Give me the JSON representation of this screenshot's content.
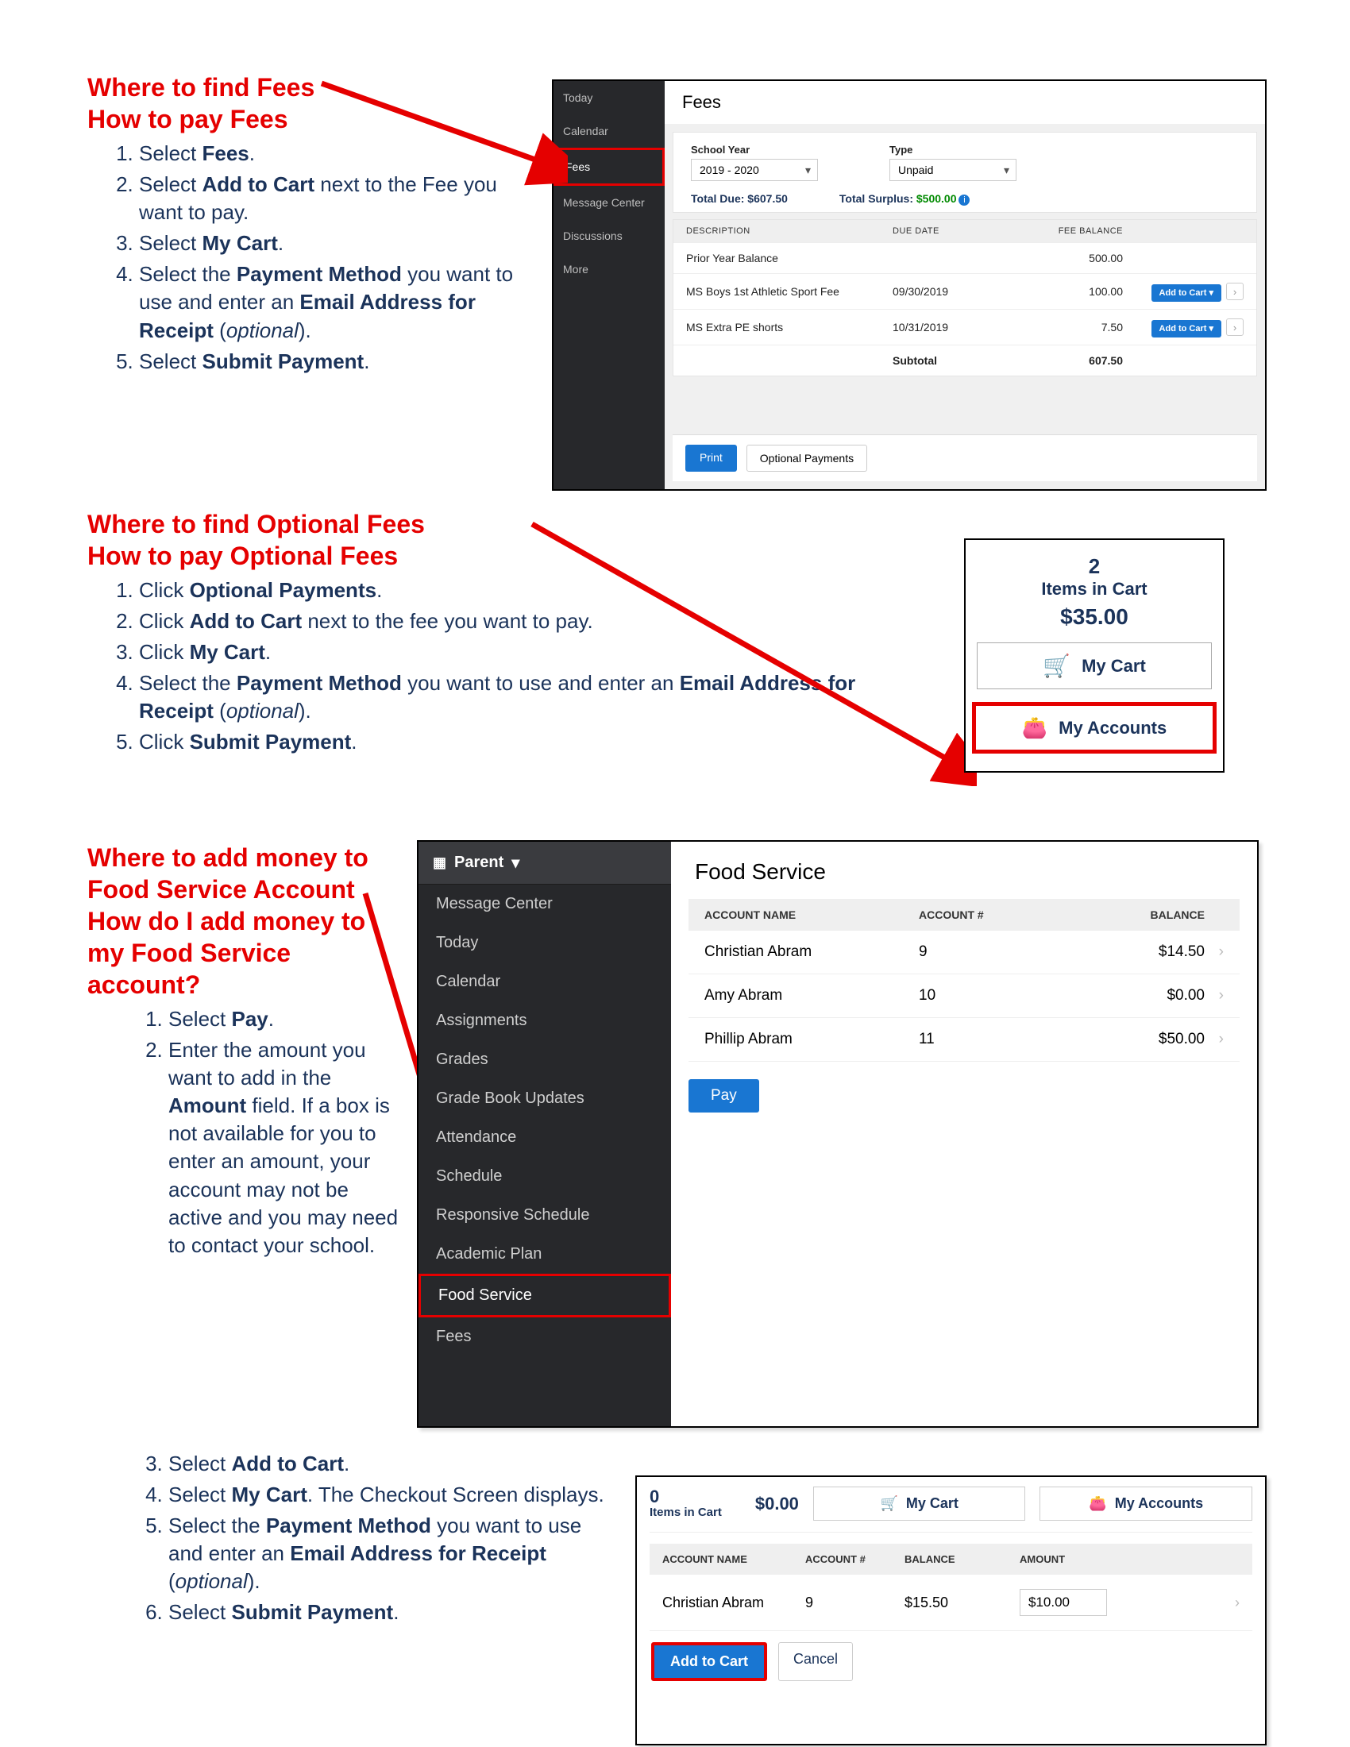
{
  "section1": {
    "h1a": "Where to find Fees",
    "h1b": "How to pay Fees",
    "steps": {
      "s1a": "Select ",
      "s1b": "Fees",
      "s1c": ".",
      "s2a": "Select ",
      "s2b": "Add to Cart",
      "s2c": " next to the Fee you want to pay.",
      "s3a": "Select ",
      "s3b": "My Cart",
      "s3c": ".",
      "s4a": "Select the ",
      "s4b": "Payment Method",
      "s4c": " you want to use and enter an ",
      "s4d": "Email Address for Receipt",
      "s4e": " (",
      "s4f": "optional",
      "s4g": ").",
      "s5a": "Select ",
      "s5b": "Submit Payment",
      "s5c": "."
    }
  },
  "fees_shot": {
    "nav": {
      "today": "Today",
      "calendar": "Calendar",
      "fees": "Fees",
      "messageCenter": "Message Center",
      "discussions": "Discussions",
      "more": "More"
    },
    "title": "Fees",
    "schoolYearLabel": "School Year",
    "schoolYearValue": "2019 - 2020",
    "typeLabel": "Type",
    "typeValue": "Unpaid",
    "totalDueLabel": "Total Due: ",
    "totalDueValue": "$607.50",
    "totalSurplusLabel": "Total Surplus: ",
    "totalSurplusValue": "$500.00",
    "thDescription": "DESCRIPTION",
    "thDueDate": "DUE DATE",
    "thFeeBalance": "FEE BALANCE",
    "rows": [
      {
        "desc": "Prior Year Balance",
        "due": "",
        "bal": "500.00",
        "btn": ""
      },
      {
        "desc": "MS Boys 1st Athletic Sport Fee",
        "due": "09/30/2019",
        "bal": "100.00",
        "btn": "Add to Cart ▾"
      },
      {
        "desc": "MS Extra PE shorts",
        "due": "10/31/2019",
        "bal": "7.50",
        "btn": "Add to Cart ▾"
      }
    ],
    "subtotalLabel": "Subtotal",
    "subtotalValue": "607.50",
    "printLabel": "Print",
    "optionalLabel": "Optional Payments"
  },
  "section2": {
    "h1a": "Where to find Optional Fees",
    "h1b": "How to pay Optional Fees",
    "steps": {
      "s1a": "Click ",
      "s1b": "Optional Payments",
      "s1c": ".",
      "s2a": "Click ",
      "s2b": "Add to Cart",
      "s2c": " next to the fee you want to pay.",
      "s3a": "Click ",
      "s3b": "My Cart",
      "s3c": ".",
      "s4a": "Select the ",
      "s4b": "Payment Method",
      "s4c": " you want to use and enter an ",
      "s4d": "Email Address for Receipt",
      "s4e": " (",
      "s4f": "optional",
      "s4g": ").",
      "s5a": "Click ",
      "s5b": "Submit Payment",
      "s5c": "."
    }
  },
  "cart_panel": {
    "count": "2",
    "countLabel": "Items in Cart",
    "total": "$35.00",
    "myCart": "My Cart",
    "myAccounts": "My Accounts"
  },
  "section3": {
    "h1a": "Where to add money to Food Service Account",
    "h1b": "How do I add money to my Food Service account?",
    "steps_a": {
      "s1a": "Select ",
      "s1b": "Pay",
      "s1c": ".",
      "s2a": "Enter the amount you want to add in the ",
      "s2b": "Amount",
      "s2c": " field. If a box is not available for you to enter an amount, your account may not be active and you may need to contact your school."
    },
    "steps_b": {
      "s3a": "Select ",
      "s3b": "Add to Cart",
      "s3c": ".",
      "s4a": "Select ",
      "s4b": "My Cart",
      "s4c": ". The Checkout Screen displays.",
      "s5a": "Select the ",
      "s5b": "Payment Method",
      "s5c": " you want to use and enter an ",
      "s5d": "Email Address for Receipt",
      "s5e": " (",
      "s5f": "optional",
      "s5g": ").",
      "s6a": "Select ",
      "s6b": "Submit Payment",
      "s6c": "."
    }
  },
  "food_shot": {
    "role": "Parent",
    "nav": [
      "Message Center",
      "Today",
      "Calendar",
      "Assignments",
      "Grades",
      "Grade Book Updates",
      "Attendance",
      "Schedule",
      "Responsive Schedule",
      "Academic Plan",
      "Food Service",
      "Fees"
    ],
    "title": "Food Service",
    "thName": "ACCOUNT NAME",
    "thNum": "ACCOUNT #",
    "thBal": "BALANCE",
    "rows": [
      {
        "name": "Christian Abram",
        "num": "9",
        "bal": "$14.50"
      },
      {
        "name": "Amy Abram",
        "num": "10",
        "bal": "$0.00"
      },
      {
        "name": "Phillip Abram",
        "num": "11",
        "bal": "$50.00"
      }
    ],
    "payLabel": "Pay"
  },
  "atc_shot": {
    "itemsCount": "0",
    "itemsLabel": "Items in Cart",
    "itemsTotal": "$0.00",
    "myCart": "My Cart",
    "myAccounts": "My Accounts",
    "thName": "ACCOUNT NAME",
    "thNum": "ACCOUNT #",
    "thBal": "BALANCE",
    "thAmt": "AMOUNT",
    "rowName": "Christian Abram",
    "rowNum": "9",
    "rowBal": "$15.50",
    "rowAmt": "$10.00",
    "addLabel": "Add to Cart",
    "cancelLabel": "Cancel"
  }
}
